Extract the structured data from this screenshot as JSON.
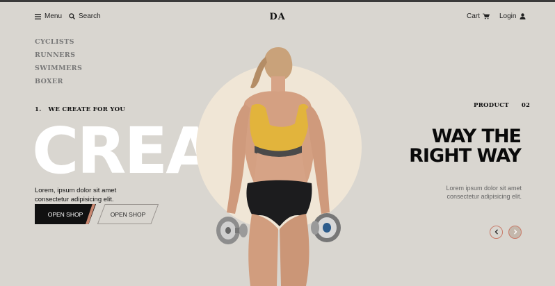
{
  "header": {
    "menu_label": "Menu",
    "search_label": "Search",
    "logo": "DA",
    "cart_label": "Cart",
    "login_label": "Login"
  },
  "categories": [
    "CYCLISTS",
    "RUNNERS",
    "SWIMMERS",
    "BOXER"
  ],
  "hero": {
    "index": "1.",
    "tagline": "WE CREATE FOR YOU",
    "big_word": "CREAT",
    "description": "Lorem, ipsum dolor sit amet consectetur adipisicing elit.",
    "primary_button": "OPEN SHOP",
    "secondary_button": "OPEN SHOP"
  },
  "product": {
    "label": "PRODUCT",
    "number": "02",
    "headline_line1": "WAY THE",
    "headline_line2": "RIGHT WAY",
    "description": "Lorem ipsum dolor sit amet consectetur adipisicing elit."
  },
  "carousel": {
    "prev_icon": "chevron-left-icon",
    "next_icon": "chevron-right-icon"
  },
  "colors": {
    "background": "#d9d6d0",
    "circle": "#f0e6d6",
    "accent": "#c98770",
    "dark": "#111111"
  }
}
